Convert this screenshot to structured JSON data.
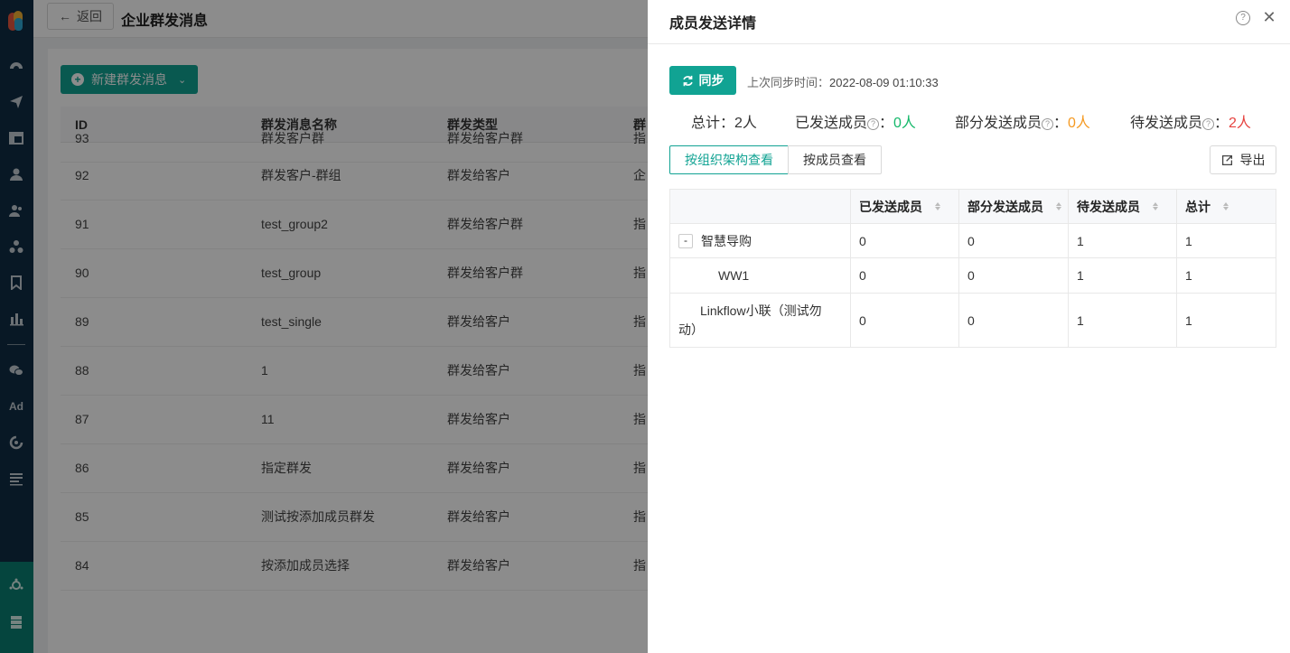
{
  "nav": {
    "items": [
      "dashboard-icon",
      "send-icon",
      "layout-icon",
      "user-icon",
      "users-icon",
      "org-icon",
      "bookmark-icon",
      "chart-icon",
      "wechat-icon",
      "ad-icon",
      "dial-icon",
      "list-icon"
    ],
    "ad_label": "Ad"
  },
  "topbar": {
    "back_label": "返回",
    "title": "企业群发消息"
  },
  "list": {
    "new_button": "新建群发消息",
    "columns": [
      "ID",
      "群发消息名称",
      "群发类型",
      "群"
    ],
    "rows": [
      {
        "id": "93",
        "name": "群发客户群",
        "type": "群发给客户群",
        "extra": "指"
      },
      {
        "id": "92",
        "name": "群发客户-群组",
        "type": "群发给客户",
        "extra": "企"
      },
      {
        "id": "91",
        "name": "test_group2",
        "type": "群发给客户群",
        "extra": "指"
      },
      {
        "id": "90",
        "name": "test_group",
        "type": "群发给客户群",
        "extra": "指"
      },
      {
        "id": "89",
        "name": "test_single",
        "type": "群发给客户",
        "extra": "指"
      },
      {
        "id": "88",
        "name": "1",
        "type": "群发给客户",
        "extra": "指"
      },
      {
        "id": "87",
        "name": "11",
        "type": "群发给客户",
        "extra": "指"
      },
      {
        "id": "86",
        "name": "指定群发",
        "type": "群发给客户",
        "extra": "指"
      },
      {
        "id": "85",
        "name": "测试按添加成员群发",
        "type": "群发给客户",
        "extra": "指"
      },
      {
        "id": "84",
        "name": "按添加成员选择",
        "type": "群发给客户",
        "extra": "指"
      }
    ]
  },
  "drawer": {
    "title": "成员发送详情",
    "sync_button": "同步",
    "sync_label": "上次同步时间：",
    "sync_time": "2022-08-09 01:10:33",
    "stats": {
      "total_label": "总计：",
      "total_value": "2人",
      "sent_label": "已发送成员",
      "sent_value": "0人",
      "partial_label": "部分发送成员",
      "partial_value": "0人",
      "pending_label": "待发送成员",
      "pending_value": "2人",
      "colon": "："
    },
    "tabs": {
      "by_org": "按组织架构查看",
      "by_member": "按成员查看"
    },
    "export_button": "导出",
    "table": {
      "columns": [
        "已发送成员",
        "部分发送成员",
        "待发送成员",
        "总计"
      ],
      "rows": [
        {
          "name": "智慧导购",
          "sent": "0",
          "partial": "0",
          "pending": "1",
          "total": "1"
        },
        {
          "name": "WW1",
          "sent": "0",
          "partial": "0",
          "pending": "1",
          "total": "1"
        },
        {
          "name": "Linkflow小联（测试勿动）",
          "sent": "0",
          "partial": "0",
          "pending": "1",
          "total": "1"
        }
      ],
      "collapse_symbol": "-"
    }
  },
  "colors": {
    "accent": "#11a393",
    "nav": "#0f2d44",
    "green": "#14b86a",
    "orange": "#f59a23",
    "red": "#e64340"
  }
}
